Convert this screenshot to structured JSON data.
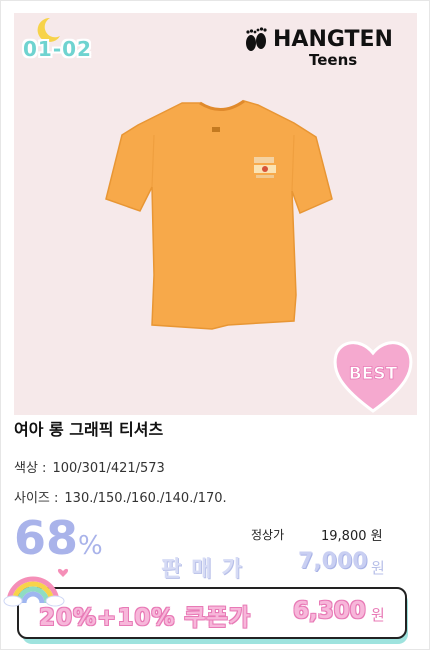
{
  "event": {
    "code": "01-02"
  },
  "brand": {
    "name": "HANGTEN",
    "sub": "Teens"
  },
  "badge": {
    "text": "BEST"
  },
  "product": {
    "title": "여아 롱 그래픽 티셔츠",
    "color_label": "색상 :",
    "color_value": "100/301/421/573",
    "size_label": "사이즈 :",
    "size_value": "130./150./160./140./170."
  },
  "pricing": {
    "discount_number": "68",
    "discount_symbol": "%",
    "regular_label": "정상가",
    "regular_price": "19,800 원",
    "sale_label": "판매가",
    "sale_price": "7,000",
    "sale_unit": "원",
    "coupon_label": "20%+10% 쿠폰가",
    "coupon_price": "6,300",
    "coupon_unit": "원"
  },
  "colors": {
    "background": "#f6e9ea",
    "shirt": "#f7a94a",
    "event_code": "#6fd3d0",
    "discount": "#a9b3ea",
    "coupon_text": "#f7b7da",
    "coupon_outline": "#e87ab6",
    "best_heart": "#f5a9cf"
  }
}
